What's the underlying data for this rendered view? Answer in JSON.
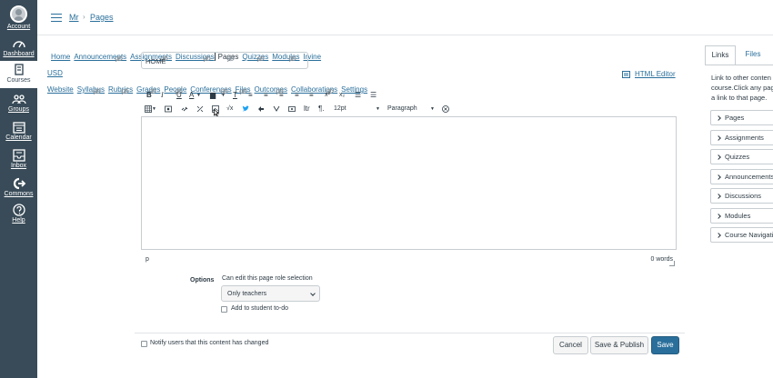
{
  "global_nav": {
    "items": [
      {
        "label": "Account",
        "icon": "avatar"
      },
      {
        "label": "Dashboard",
        "icon": "dashboard-icon"
      },
      {
        "label": "Courses",
        "icon": "courses-icon",
        "active": true
      },
      {
        "label": "Groups",
        "icon": "groups-icon"
      },
      {
        "label": "Calendar",
        "icon": "calendar-icon"
      },
      {
        "label": "Inbox",
        "icon": "inbox-icon"
      },
      {
        "label": "Commons",
        "icon": "commons-icon"
      },
      {
        "label": "Help",
        "icon": "help-icon"
      }
    ]
  },
  "breadcrumb": {
    "course": "Mr",
    "separator": "›",
    "page": "Pages"
  },
  "course_nav": {
    "items": [
      {
        "label": "Home",
        "hidden_icon": false
      },
      {
        "label": "Announcements",
        "hidden_icon": true
      },
      {
        "label": "Assignments",
        "hidden_icon": true
      },
      {
        "label": "Discussions",
        "hidden_icon": true
      },
      {
        "label": "Pages",
        "hidden_icon": true,
        "active": true
      },
      {
        "label": "Quizzes",
        "hidden_icon": true
      },
      {
        "label": "Modules",
        "hidden_icon": true
      },
      {
        "label": "Irvine USD Website",
        "hidden_icon": false
      },
      {
        "label": "Syllabus",
        "hidden_icon": true
      },
      {
        "label": "Rubrics",
        "hidden_icon": true
      },
      {
        "label": "Grades",
        "hidden_icon": true
      },
      {
        "label": "People",
        "hidden_icon": true
      },
      {
        "label": "Conferences",
        "hidden_icon": true
      },
      {
        "label": "Files",
        "hidden_icon": true
      },
      {
        "label": "Outcomes",
        "hidden_icon": true
      },
      {
        "label": "Collaborations",
        "hidden_icon": true
      },
      {
        "label": "Settings",
        "hidden_icon": false
      }
    ]
  },
  "editor": {
    "title_value": "HOME",
    "html_editor_link": "HTML Editor",
    "font_size": "12pt",
    "block_format": "Paragraph",
    "status_path": "p",
    "word_count": "0 words",
    "toolbar_row1": [
      "B",
      "I",
      "U",
      "A",
      "▆",
      "T",
      "≡",
      "≡",
      "≡",
      "≡",
      "≡",
      "x²",
      "x₂",
      "☰",
      "☰"
    ],
    "toolbar_row2": [
      "table",
      "media",
      "link",
      "unlink",
      "image",
      "√x",
      "twitter",
      "embed",
      "youtube",
      "record",
      "ltr",
      "pilcrow"
    ]
  },
  "options": {
    "label": "Options",
    "edit_desc": "Can edit this page role selection",
    "role_selected": "Only teachers",
    "todo_label": "Add to student to-do"
  },
  "footer": {
    "notify_label": "Notify users that this content has changed",
    "cancel": "Cancel",
    "save_publish": "Save & Publish",
    "save": "Save"
  },
  "sidebar": {
    "tabs": [
      "Links",
      "Files"
    ],
    "desc_lines": [
      "Link to other conten",
      "course.Click any pag",
      "a link to that page."
    ],
    "sections": [
      "Pages",
      "Assignments",
      "Quizzes",
      "Announcements",
      "Discussions",
      "Modules",
      "Course Navigation"
    ]
  },
  "colors": {
    "nav_bg": "#394b58",
    "link": "#2a6f9b",
    "primary": "#2a6f9b",
    "text": "#2d3b45",
    "border": "#c7cdd1"
  }
}
